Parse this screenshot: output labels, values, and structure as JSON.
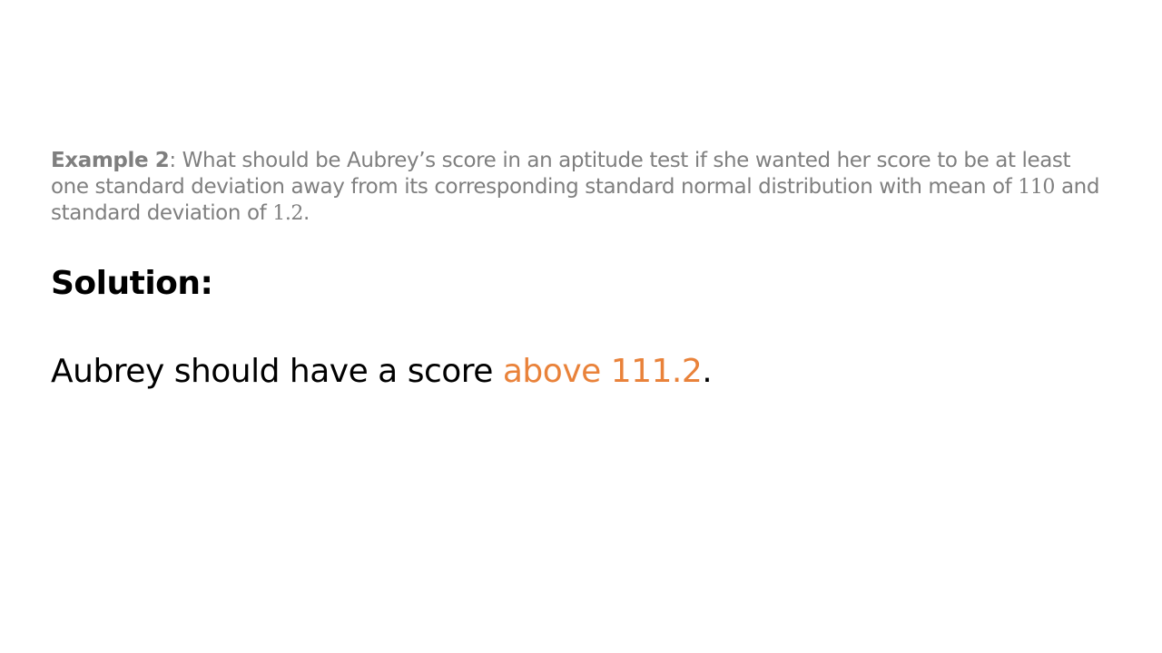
{
  "problem": {
    "label": "Example 2",
    "colon": ": ",
    "text_before_mean": "What should be Aubrey’s score in an aptitude test if she wanted her score to be at least one standard deviation away from its corresponding standard normal distribution with mean of ",
    "mean": "110",
    "text_between": " and standard deviation of ",
    "sd": "1.2",
    "end": "."
  },
  "solution": {
    "heading": "Solution:",
    "answer_prefix": "Aubrey should have a score ",
    "answer_highlight": "above 111.2",
    "answer_suffix": "."
  },
  "colors": {
    "problem_text": "#7f7f7f",
    "highlight": "#e9823a"
  }
}
